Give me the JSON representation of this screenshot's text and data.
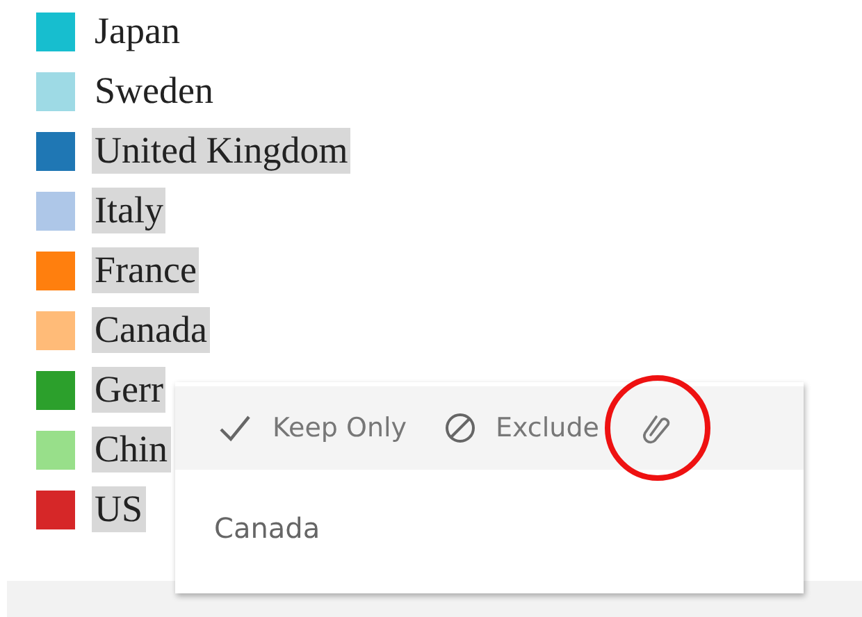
{
  "legend": [
    {
      "label": "Japan",
      "color": "#17becf",
      "selected": false
    },
    {
      "label": "Sweden",
      "color": "#9edae5",
      "selected": false
    },
    {
      "label": "United Kingdom",
      "color": "#1f77b4",
      "selected": true
    },
    {
      "label": "Italy",
      "color": "#aec7e8",
      "selected": true
    },
    {
      "label": "France",
      "color": "#ff7f0e",
      "selected": true
    },
    {
      "label": "Canada",
      "color": "#ffbb78",
      "selected": true
    },
    {
      "label": "Gerr",
      "color": "#2ca02c",
      "selected": true
    },
    {
      "label": "Chin",
      "color": "#98df8a",
      "selected": true
    },
    {
      "label": "US",
      "color": "#d62728",
      "selected": true
    }
  ],
  "popup": {
    "actions": [
      {
        "kind": "keep",
        "label": "Keep Only"
      },
      {
        "kind": "exclude",
        "label": "Exclude"
      },
      {
        "kind": "attach",
        "highlighted": true
      }
    ],
    "value": "Canada"
  }
}
